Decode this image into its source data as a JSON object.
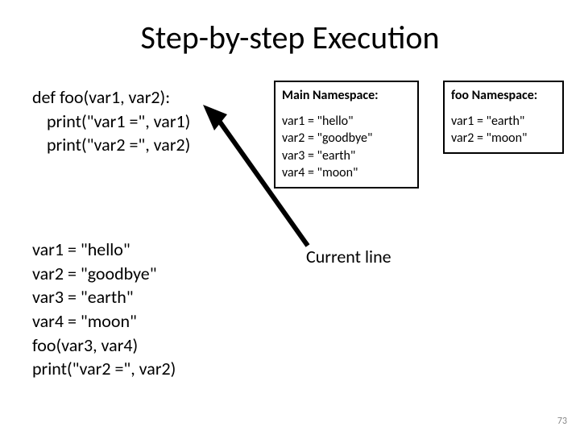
{
  "title": "Step-by-step Execution",
  "code1": {
    "line1": "def foo(var1, var2):",
    "line2": "print(\"var1 =\", var1)",
    "line3": "print(\"var2 =\", var2)"
  },
  "code2": {
    "line1": "var1 = \"hello\"",
    "line2": "var2 = \"goodbye\"",
    "line3": "var3 = \"earth\"",
    "line4": "var4 = \"moon\"",
    "line5": "foo(var3, var4)",
    "line6": "print(\"var2 =\", var2)"
  },
  "main_ns": {
    "header": "Main Namespace:",
    "line1": "var1 = \"hello\"",
    "line2": "var2 = \"goodbye\"",
    "line3": "var3 = \"earth\"",
    "line4": "var4 = \"moon\""
  },
  "foo_ns": {
    "header": "foo Namespace:",
    "line1": "var1 = \"earth\"",
    "line2": "var2 = \"moon\""
  },
  "current_line_label": "Current line",
  "page_num": "73"
}
